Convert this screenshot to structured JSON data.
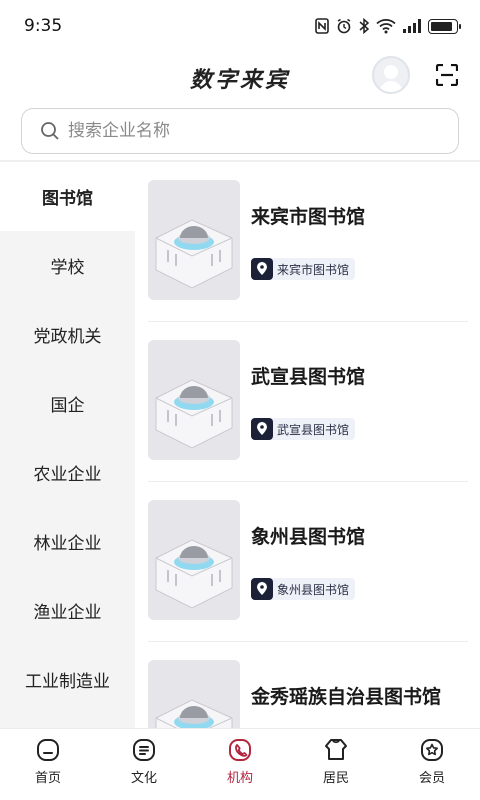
{
  "status_bar": {
    "time": "9:35",
    "icons": [
      "nfc-icon",
      "alarm-icon",
      "bluetooth-icon",
      "wifi-icon",
      "signal-icon",
      "battery-icon"
    ],
    "battery_level": 0.9
  },
  "header": {
    "title": "数字来宾",
    "avatar_icon": "avatar-icon",
    "scan_icon": "scan-icon"
  },
  "search": {
    "placeholder": "搜索企业名称",
    "value": ""
  },
  "sidebar": {
    "items": [
      {
        "label": "图书馆",
        "active": true
      },
      {
        "label": "学校",
        "active": false
      },
      {
        "label": "党政机关",
        "active": false
      },
      {
        "label": "国企",
        "active": false
      },
      {
        "label": "农业企业",
        "active": false
      },
      {
        "label": "林业企业",
        "active": false
      },
      {
        "label": "渔业企业",
        "active": false
      },
      {
        "label": "工业制造业",
        "active": false
      }
    ]
  },
  "list": {
    "items": [
      {
        "name": "来宾市图书馆",
        "tag": "来宾市图书馆"
      },
      {
        "name": "武宣县图书馆",
        "tag": "武宣县图书馆"
      },
      {
        "name": "象州县图书馆",
        "tag": "象州县图书馆"
      },
      {
        "name": "金秀瑶族自治县图书馆",
        "tag": ""
      }
    ]
  },
  "tabbar": {
    "tabs": [
      {
        "label": "首页",
        "icon": "home-icon",
        "active": false
      },
      {
        "label": "文化",
        "icon": "culture-icon",
        "active": false
      },
      {
        "label": "机构",
        "icon": "institution-icon",
        "active": true
      },
      {
        "label": "居民",
        "icon": "resident-icon",
        "active": false
      },
      {
        "label": "会员",
        "icon": "member-icon",
        "active": false
      }
    ]
  },
  "colors": {
    "accent": "#b3263e",
    "sidebar_bg": "#f4f4f4",
    "tag_bg": "#eef1f8",
    "pin_bg": "#1c2138"
  }
}
